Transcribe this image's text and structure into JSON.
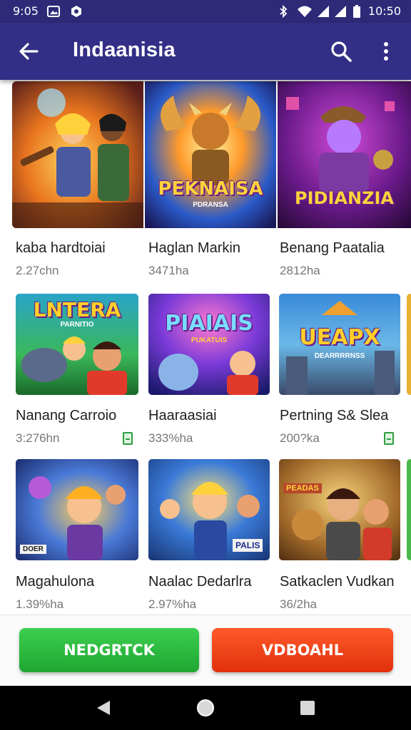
{
  "status_bar": {
    "time_left": "9:05",
    "time_right": "10:50",
    "icons": [
      "gallery-icon",
      "notification-icon",
      "bluetooth-icon",
      "wifi-icon",
      "signal-icon",
      "signal-icon",
      "battery-icon"
    ]
  },
  "app_bar": {
    "title": "Indaanisia",
    "icons": [
      "back-arrow-icon",
      "search-icon",
      "more-vert-icon"
    ]
  },
  "games": [
    {
      "name": "kaba hardtoiai",
      "size": "2.27chn",
      "badge": false,
      "art_text": "",
      "art_sub": ""
    },
    {
      "name": "Haglan Markin",
      "size": "3471ha",
      "badge": false,
      "art_text": "PEKNAISA",
      "art_sub": "PDRANSA"
    },
    {
      "name": "Benang Paatalia",
      "size": "2812ha",
      "badge": false,
      "art_text": "PIDIANZIA",
      "art_sub": ""
    },
    {
      "name": "Nanang Carroio",
      "size": "3:276hn",
      "badge": true,
      "art_text": "LNTERA",
      "art_sub": "PARNITIO"
    },
    {
      "name": "Haaraasiai",
      "size": "333%ha",
      "badge": false,
      "art_text": "PIAIAIS",
      "art_sub": "PUKATUIS"
    },
    {
      "name": "Pertning S& Slea",
      "size": "200?ka",
      "badge": true,
      "art_text": "UEAPX",
      "art_sub": "DEARRRRNSS"
    },
    {
      "name": "Magahulona",
      "size": "1.39%ha",
      "badge": false,
      "art_text": "",
      "art_sub": "DOER"
    },
    {
      "name": "Naalac Dedarlra",
      "size": "2.97%ha",
      "badge": false,
      "art_text": "",
      "art_sub": "PALIS"
    },
    {
      "name": "Satkaclen Vudkan",
      "size": "36/2ha",
      "badge": false,
      "art_text": "",
      "art_sub": "PEADAS"
    }
  ],
  "actions": {
    "primary": "NEDGRTCK",
    "secondary": "VDBOAHL"
  },
  "nav_bar": {
    "icons": [
      "back-triangle-icon",
      "home-circle-icon",
      "recents-square-icon"
    ]
  },
  "colors": {
    "app_bar": "#332f86",
    "primary_button": "#2bb93e",
    "secondary_button": "#f0421a"
  }
}
